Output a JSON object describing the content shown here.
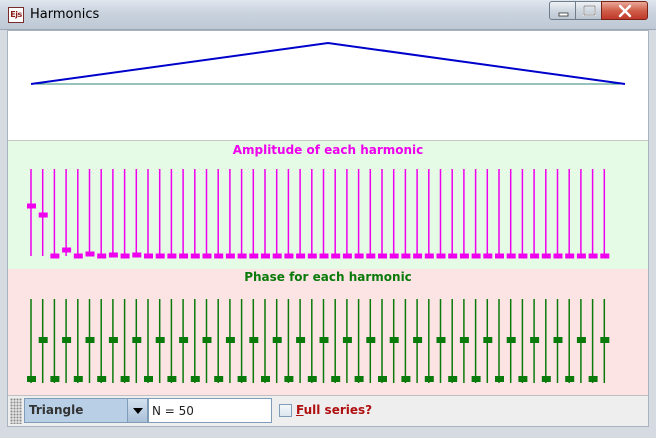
{
  "window": {
    "title": "Harmonics",
    "app_icon_text": "Ejs"
  },
  "colors": {
    "amplitude": "#ee00ee",
    "phase": "#0a7a0a",
    "waveform": "#0000cc",
    "axis": "#2d8a7a",
    "amplitude_bg": "#e6fbe6",
    "phase_bg": "#fde4e4"
  },
  "labels": {
    "amplitude": "Amplitude of each harmonic",
    "phase": "Phase for each harmonic"
  },
  "harmonics": {
    "amplitude_levels": [
      0.5,
      0.41,
      0.0,
      0.06,
      0.0,
      0.02,
      0.0,
      0.01,
      0.0,
      0.01,
      0.0,
      0.0,
      0.0,
      0.0,
      0.0,
      0.0,
      0.0,
      0.0,
      0.0,
      0.0,
      0.0,
      0.0,
      0.0,
      0.0,
      0.0,
      0.0,
      0.0,
      0.0,
      0.0,
      0.0,
      0.0,
      0.0,
      0.0,
      0.0,
      0.0,
      0.0,
      0.0,
      0.0,
      0.0,
      0.0,
      0.0,
      0.0,
      0.0,
      0.0,
      0.0,
      0.0,
      0.0,
      0.0,
      0.0,
      0.0
    ],
    "phase_levels": [
      0,
      1,
      0,
      1,
      0,
      1,
      0,
      1,
      0,
      1,
      0,
      1,
      0,
      1,
      0,
      1,
      0,
      1,
      0,
      1,
      0,
      1,
      0,
      1,
      0,
      1,
      0,
      1,
      0,
      1,
      0,
      1,
      0,
      1,
      0,
      1,
      0,
      1,
      0,
      1,
      0,
      1,
      0,
      1,
      0,
      1,
      0,
      1,
      0,
      1
    ]
  },
  "controls": {
    "wave_type": "Triangle",
    "n_field": "N = 50",
    "full_series_label": "ull series?",
    "full_series_mnemonic": "F",
    "full_series_checked": false
  },
  "icons": {
    "minimize": "minimize-icon",
    "maximize": "maximize-icon",
    "close": "close-icon",
    "dropdown": "chevron-down-icon"
  }
}
